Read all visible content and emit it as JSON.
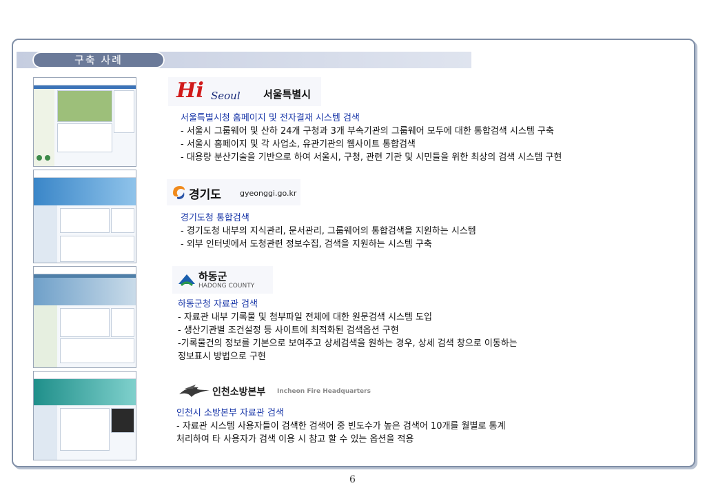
{
  "header": {
    "title": "구축 사례"
  },
  "cases": [
    {
      "logo": {
        "mark": "Hi",
        "script": "Seoul",
        "name": "서울특별시"
      },
      "title": "서울특별시청 홈페이지 및 전자결재 시스템 검색",
      "lines": [
        "- 서울시 그룹웨어 및 산하 24개 구청과 3개  부속기관의 그룹웨어 모두에 대한 통합검색 시스템 구축",
        "- 서울시 홈페이지 및 각 사업소, 유관기관의 웹사이트 통합검색",
        "- 대용량 분산기술을 기반으로 하여 서울시, 구청, 관련 기관 및 시민들을 위한 최상의 검색 시스템 구현"
      ]
    },
    {
      "logo": {
        "name": "경기도",
        "url": "gyeonggi.go.kr"
      },
      "title": "경기도청 통합검색",
      "lines": [
        "- 경기도청 내부의 지식관리, 문서관리, 그룹웨어의 통합검색을 지원하는 시스템",
        "- 외부 인터넷에서 도청관련 정보수집, 검색을 지원하는  시스템 구축"
      ]
    },
    {
      "logo": {
        "name": "하동군",
        "sub": "HADONG COUNTY"
      },
      "title": "하동군청 자료관 검색",
      "lines": [
        "- 자료관 내부 기록물 및 첨부파일 전체에 대한 원문검색  시스템 도입",
        "- 생산기관별 조건설정 등 사이트에 최적화된 검색옵션 구현",
        "-기록물건의 정보를 기본으로 보여주고 상세검색을 원하는 경우, 상세 검색 창으로 이동하는",
        "정보표시 방법으로 구현"
      ]
    },
    {
      "logo": {
        "name": "인천소방본부",
        "sub": "Incheon Fire Headquarters"
      },
      "title": "인천시 소방본부 자료관 검색",
      "lines": [
        "- 자료관 시스템 사용자들이 검색한 검색어 중 빈도수가 높은 검색어 10개를 월별로 통계",
        "처리하여 타 사용자가  검색 이용 시 참고 할 수 있는 옵션을 적용"
      ]
    }
  ],
  "footer": {
    "page": "6"
  }
}
